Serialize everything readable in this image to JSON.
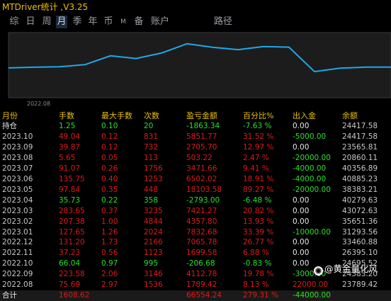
{
  "app": {
    "title": "MTDriver统计 ,V3.25"
  },
  "tabs": [
    {
      "label": "综"
    },
    {
      "label": "日"
    },
    {
      "label": "周"
    },
    {
      "label": "月"
    },
    {
      "label": "季"
    },
    {
      "label": "年"
    },
    {
      "label": "币"
    },
    {
      "label": "M"
    },
    {
      "label": "备"
    },
    {
      "label": "账户"
    },
    {
      "label": "路径"
    }
  ],
  "active_tab": "月",
  "chart_data": {
    "type": "line",
    "x_label_visible": "2022.08",
    "x": [
      "2022.08",
      "2022.09",
      "2022.10",
      "2022.11",
      "2022.12",
      "2023.01",
      "2023.02",
      "2023.03",
      "2023.04",
      "2023.05",
      "2023.06",
      "2023.07",
      "2023.08",
      "2023.09",
      "2023.10",
      "持仓"
    ],
    "values": [
      23789.42,
      24383.2,
      24695.52,
      26395.1,
      33460.88,
      31293.56,
      35651.36,
      43072.63,
      40279.63,
      38383.21,
      40885.23,
      40356.89,
      20860.11,
      23565.81,
      24417.58,
      24417.58
    ],
    "line_color": "#1fa8e8",
    "grid": true
  },
  "table": {
    "headers": [
      "月份",
      "手数",
      "最大手数",
      "次数",
      "盈亏金额",
      "百分比%",
      "出入金",
      "余额"
    ],
    "rows": [
      [
        "持仓",
        "1.25",
        "0.10",
        "20",
        "-1863.34",
        "-7.63 %",
        "0.00",
        "24417.58"
      ],
      [
        "2023.10",
        "49.04",
        "0.12",
        "831",
        "5851.77",
        "31.52 %",
        "-5000.00",
        "24417.58"
      ],
      [
        "2023.09",
        "39.87",
        "0.12",
        "732",
        "2705.70",
        "12.97 %",
        "0.00",
        "23565.81"
      ],
      [
        "2023.08",
        "5.65",
        "0.05",
        "113",
        "503.22",
        "2.47 %",
        "-20000.00",
        "20860.11"
      ],
      [
        "2023.07",
        "91.07",
        "0.26",
        "1756",
        "3471.66",
        "9.41 %",
        "-4000.00",
        "40356.89"
      ],
      [
        "2023.06",
        "135.75",
        "0.40",
        "1253",
        "6502.02",
        "18.91 %",
        "-4000.00",
        "40885.23"
      ],
      [
        "2023.05",
        "97.84",
        "0.35",
        "448",
        "18103.58",
        "89.27 %",
        "-20000.00",
        "38383.21"
      ],
      [
        "2023.04",
        "35.73",
        "0.22",
        "358",
        "-2793.00",
        "-6.48 %",
        "0.00",
        "40279.63"
      ],
      [
        "2023.03",
        "283.65",
        "0.37",
        "3235",
        "7421.27",
        "20.82 %",
        "0.00",
        "43072.63"
      ],
      [
        "2023.02",
        "207.38",
        "1.00",
        "4844",
        "4357.80",
        "13.93 %",
        "0.00",
        "35651.36"
      ],
      [
        "2023.01",
        "127.65",
        "1.26",
        "2024",
        "7832.68",
        "33.39 %",
        "-10000.00",
        "31293.56"
      ],
      [
        "2022.12",
        "131.20",
        "1.73",
        "2166",
        "7065.78",
        "26.77 %",
        "0.00",
        "33460.88"
      ],
      [
        "2022.11",
        "37.23",
        "0.56",
        "1123",
        "1699.58",
        "6.88 %",
        "0.00",
        "26395.10"
      ],
      [
        "2022.10",
        "66.04",
        "0.97",
        "995",
        "-206.68",
        "-0.83 %",
        "0.00",
        "24695.52"
      ],
      [
        "2022.09",
        "223.58",
        "2.06",
        "3146",
        "4112.78",
        "19.78 %",
        "-3000.00",
        "24383.20"
      ],
      [
        "2022.08",
        "75.69",
        "2.97",
        "1536",
        "1789.42",
        "8.13 %",
        "22000.00",
        "23789.42"
      ]
    ],
    "total": [
      "合计",
      "1608.62",
      "",
      "",
      "66554.24",
      "279.31 %",
      "-44000.00",
      ""
    ]
  },
  "watermark": {
    "icon": "weibo-like-icon",
    "text": "@黄金量化风"
  }
}
